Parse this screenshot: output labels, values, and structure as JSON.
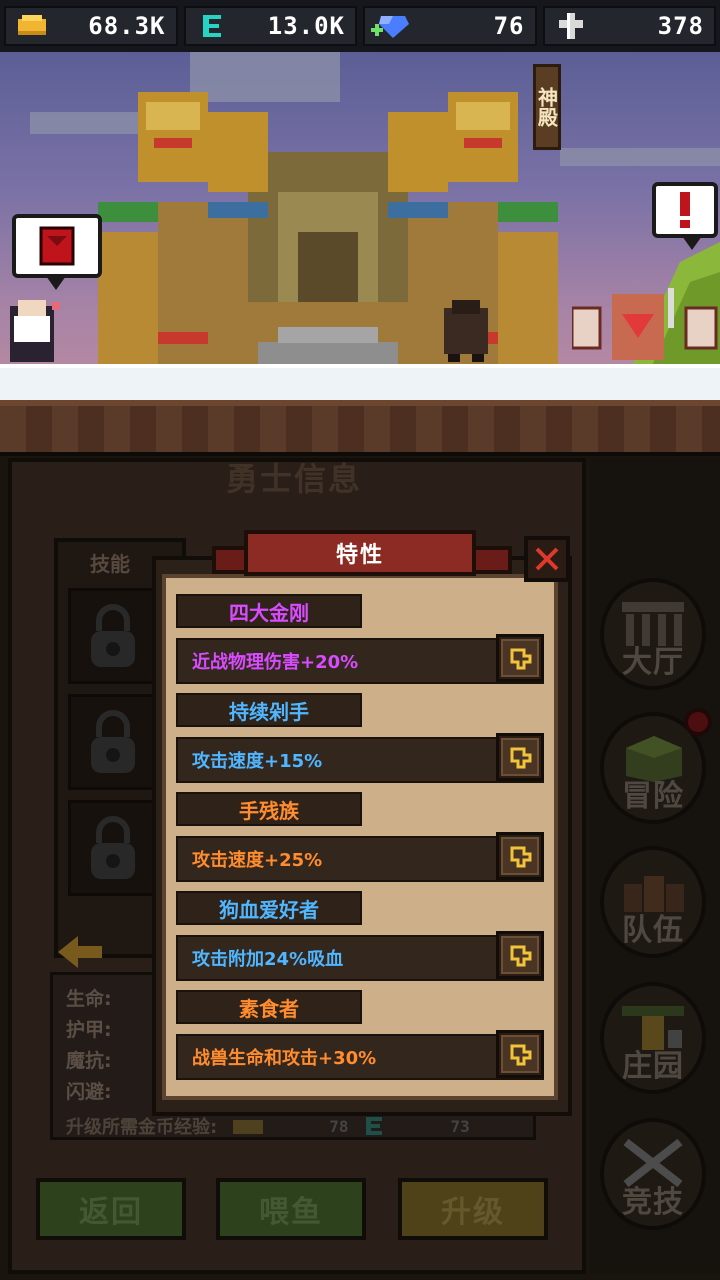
{
  "resources": [
    {
      "icon": "gold-icon",
      "value": "68.3K"
    },
    {
      "icon": "energy-icon",
      "value": "13.0K"
    },
    {
      "icon": "diamond-icon",
      "value": "76"
    },
    {
      "icon": "cross-icon",
      "value": "378"
    }
  ],
  "scene": {
    "shrine_sign": "神殿"
  },
  "panel": {
    "title": "勇士信息",
    "skills_title": "技能",
    "stats": {
      "hp": "生命:",
      "armor": "护甲:",
      "magic_resist": "魔抗:",
      "dodge": "闪避:"
    },
    "upgrade_exp_label": "升级所需金币经验:",
    "upgrade_gold": "78",
    "upgrade_energy": "73",
    "buttons": {
      "back": "返回",
      "feed": "喂鱼",
      "upgrade": "升级"
    }
  },
  "nav": [
    {
      "label": "大厅",
      "icon": "hall-icon"
    },
    {
      "label": "冒险",
      "icon": "adventure-icon"
    },
    {
      "label": "队伍",
      "icon": "team-icon"
    },
    {
      "label": "庄园",
      "icon": "manor-icon"
    },
    {
      "label": "竞技",
      "icon": "arena-icon"
    }
  ],
  "modal": {
    "title": "特性",
    "traits": [
      {
        "name": "四大金刚",
        "effect": "近战物理伤害+20%",
        "rarity_color": "#d84cff"
      },
      {
        "name": "持续剁手",
        "effect": "攻击速度+15%",
        "rarity_color": "#4fb6ff"
      },
      {
        "name": "手残族",
        "effect": "攻击速度+25%",
        "rarity_color": "#ff8c2e"
      },
      {
        "name": "狗血爱好者",
        "effect": "攻击附加24%吸血",
        "rarity_color": "#4fb6ff"
      },
      {
        "name": "素食者",
        "effect": "战兽生命和攻击+30%",
        "rarity_color": "#ff8c2e"
      }
    ]
  },
  "colors": {
    "gold": "#f2b531",
    "energy": "#27d3c4",
    "diamond": "#4b7dff",
    "close": "#e0382a"
  }
}
